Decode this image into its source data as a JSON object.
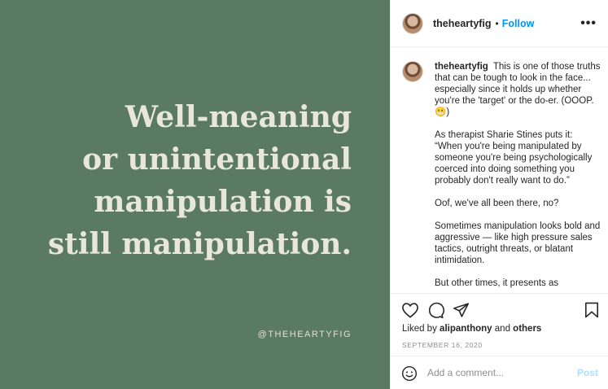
{
  "media": {
    "quote_lines": [
      "Well-meaning",
      "or unintentional",
      "manipulation is",
      "still manipulation."
    ],
    "handle": "@THEHEARTYFIG"
  },
  "header": {
    "username": "theheartyfig",
    "separator": "•",
    "follow_label": "Follow",
    "more_label": "•••"
  },
  "caption": {
    "username": "theheartyfig",
    "paragraphs": [
      "This is one of those truths that can be tough to look in the face... especially since it holds up whether you're the 'target' or the do-er. (OOOP. 😬)",
      "As therapist Sharie Stines puts it: “When you're being manipulated by someone you're being psychologically coerced into doing something you probably don't really want to do.”",
      "Oof, we've all been there, no?",
      "Sometimes manipulation looks bold and aggressive — like high pressure sales tactics, outright threats, or blatant intimidation.",
      "But other times, it presents as"
    ]
  },
  "actions": {
    "liked_by_prefix": "Liked by",
    "liked_by_user": "alipanthony",
    "liked_by_and": "and",
    "liked_by_others": "others",
    "date": "SEPTEMBER 16, 2020"
  },
  "comment": {
    "placeholder": "Add a comment...",
    "post_label": "Post"
  },
  "colors": {
    "media_bg": "#5a7a63",
    "quote_text": "#e9e6dc",
    "follow_blue": "#0095f6",
    "post_disabled": "#b2dffc"
  },
  "icons": [
    "heart-icon",
    "comment-icon",
    "share-icon",
    "bookmark-icon",
    "emoji-icon",
    "more-icon"
  ]
}
